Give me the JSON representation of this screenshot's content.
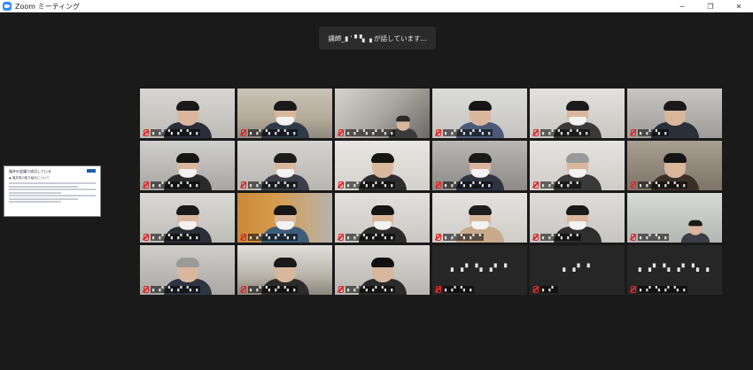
{
  "window": {
    "title": "Zoom ミーティング",
    "minimize_glyph": "─",
    "restore_glyph": "❐",
    "close_glyph": "✕"
  },
  "speaker": {
    "banner_text": "講師_▮ ' ▘▚ ▗ が話しています..."
  },
  "share": {
    "title": "福井の会議で成功している",
    "subtitle": "◆ 福井県の取り組みについて"
  },
  "colors": {
    "accent": "#2d8cff",
    "mic_muted": "#e02828",
    "stage_bg": "#1a1a1a"
  },
  "participants": [
    {
      "name": "▖▗▘▝▖▗▘▝▖▗"
    },
    {
      "name": "▖▗▘▝▖▗▘▝▖▗"
    },
    {
      "name": "▖▗▘▝▖▗▘▝▖▗"
    },
    {
      "name": "▖▗▘▝▖▗▘▝▖▗"
    },
    {
      "name": "▖▗▘▝▖▗▘▝▖▗"
    },
    {
      "name": "▖▗▘▝▖▗"
    },
    {
      "name": "▖▗▘▝▖▗▘▝▖▗"
    },
    {
      "name": "▖▗▘▝▖▗▘▝▖▗"
    },
    {
      "name": "▖▗▘▝▖▗▘▝▖▗"
    },
    {
      "name": "▖▗▘▝▖▗▘▝▖▗"
    },
    {
      "name": "▖▗▘▝▖▗▘▝"
    },
    {
      "name": "▖▗▘▝▖▗▘▝▖▗"
    },
    {
      "name": "▖▗▘▝▖▗▘▝▖▗"
    },
    {
      "name": "▖▗▘▝▖▗▘▝▖▗"
    },
    {
      "name": "▖▗▘▝▖▗▘▝▖▗"
    },
    {
      "name": "▖▗▘▝▖▗▘▝"
    },
    {
      "name": "▖▗▘▝▖▗▘▝"
    },
    {
      "name": "▖▗▘▝▖▗"
    },
    {
      "name": "▖▗▘▝▖▗▘▝▖▗"
    },
    {
      "name": "▖▗▘▝▖▗▘▝▖▗"
    },
    {
      "name": "▖▗▘▝▖▗▘▝▖▗"
    },
    {
      "name": "▖▗▘▝▖▗",
      "center_name": "▖▗▘▝▖▗▘▝"
    },
    {
      "name": "▖▗▘",
      "center_name": "▖▗▘▝"
    },
    {
      "name": "▖▗▘▝▖▗▘▝▖▗",
      "center_name": "▖▗▘▝▖▗▘▝▖▗"
    }
  ]
}
